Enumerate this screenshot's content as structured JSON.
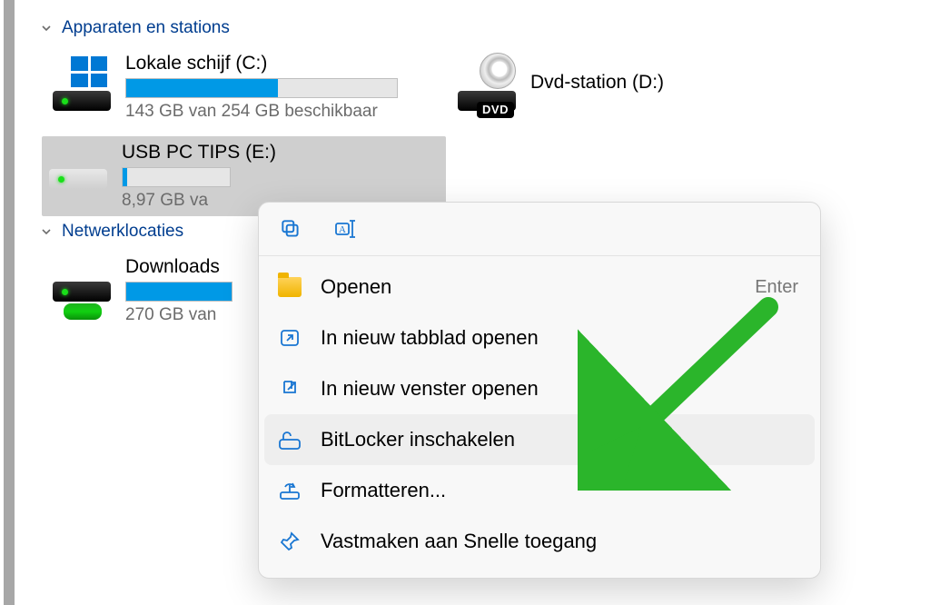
{
  "sections": {
    "devices_label": "Apparaten en stations",
    "network_label": "Netwerklocaties"
  },
  "drives": {
    "local": {
      "title": "Lokale schijf (C:)",
      "subtitle": "143 GB van 254 GB beschikbaar",
      "fill_percent": 56
    },
    "dvd": {
      "title": "Dvd-station (D:)",
      "badge": "DVD"
    },
    "usb": {
      "title": "USB PC TIPS (E:)",
      "subtitle": "8,97 GB va",
      "fill_percent": 4
    },
    "downloads": {
      "title": "Downloads",
      "subtitle": "270 GB van",
      "fill_percent": 100
    }
  },
  "context_menu": {
    "open": "Openen",
    "open_hint": "Enter",
    "new_tab": "In nieuw tabblad openen",
    "new_window": "In nieuw venster openen",
    "bitlocker": "BitLocker inschakelen",
    "format": "Formatteren...",
    "pin_quick": "Vastmaken aan Snelle toegang"
  }
}
